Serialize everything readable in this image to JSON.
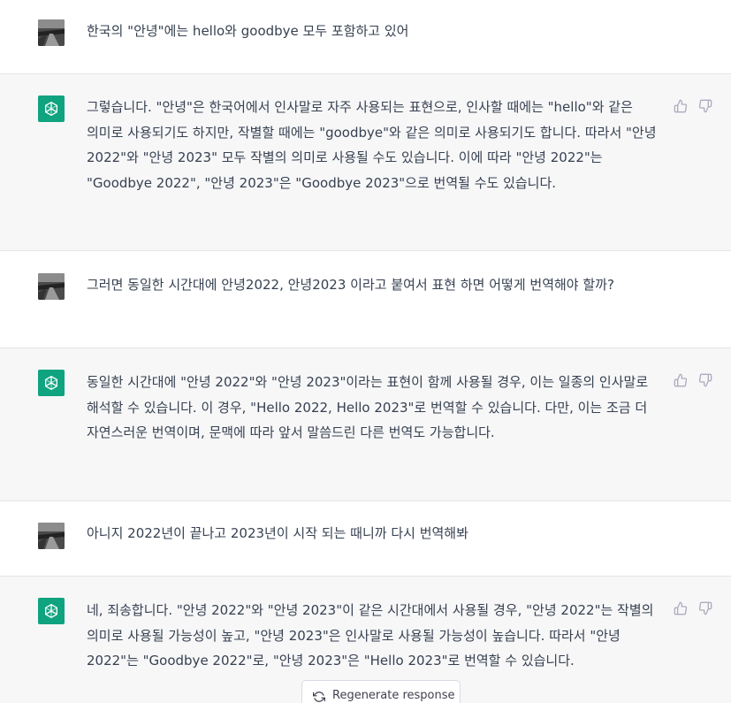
{
  "messages": [
    {
      "role": "user",
      "text": "한국의 \"안녕\"에는 hello와 goodbye 모두 포함하고 있어"
    },
    {
      "role": "assistant",
      "text": "그렇습니다. \"안녕\"은 한국어에서 인사말로 자주 사용되는 표현으로, 인사할 때에는 \"hello\"와 같은 의미로 사용되기도 하지만, 작별할 때에는 \"goodbye\"와 같은 의미로 사용되기도 합니다. 따라서 \"안녕 2022\"와 \"안녕 2023\" 모두 작별의 의미로 사용될 수도 있습니다. 이에 따라 \"안녕 2022\"는 \"Goodbye 2022\", \"안녕 2023\"은 \"Goodbye 2023\"으로 번역될 수도 있습니다."
    },
    {
      "role": "user",
      "text": "그러면 동일한 시간대에 안녕2022, 안녕2023 이라고 붙여서 표현 하면 어떻게 번역해야 할까?"
    },
    {
      "role": "assistant",
      "text": "동일한 시간대에 \"안녕 2022\"와 \"안녕 2023\"이라는 표현이 함께 사용될 경우, 이는 일종의 인사말로 해석할 수 있습니다. 이 경우, \"Hello 2022, Hello 2023\"로 번역할 수 있습니다. 다만, 이는 조금 더 자연스러운 번역이며, 문맥에 따라 앞서 말씀드린 다른 번역도 가능합니다."
    },
    {
      "role": "user",
      "text": "아니지 2022년이 끝나고 2023년이 시작 되는 때니까 다시 번역해봐"
    },
    {
      "role": "assistant",
      "text": "네, 죄송합니다. \"안녕 2022\"와 \"안녕 2023\"이 같은 시간대에서 사용될 경우, \"안녕 2022\"는 작별의 의미로 사용될 가능성이 높고, \"안녕 2023\"은 인사말로 사용될 가능성이 높습니다. 따라서 \"안녕 2022\"는 \"Goodbye 2022\"로, \"안녕 2023\"은 \"Hello 2023\"로 번역할 수 있습니다."
    }
  ],
  "regenerate": {
    "label": "Regenerate response",
    "icon": "refresh-icon"
  },
  "icons": {
    "feedback_up": "thumbs-up-icon",
    "feedback_down": "thumbs-down-icon",
    "assistant_avatar": "openai-logo-icon"
  },
  "colors": {
    "assistant_bg": "#f7f7f8",
    "user_bg": "#ffffff",
    "avatar_green": "#10a37f",
    "text": "#374151"
  }
}
